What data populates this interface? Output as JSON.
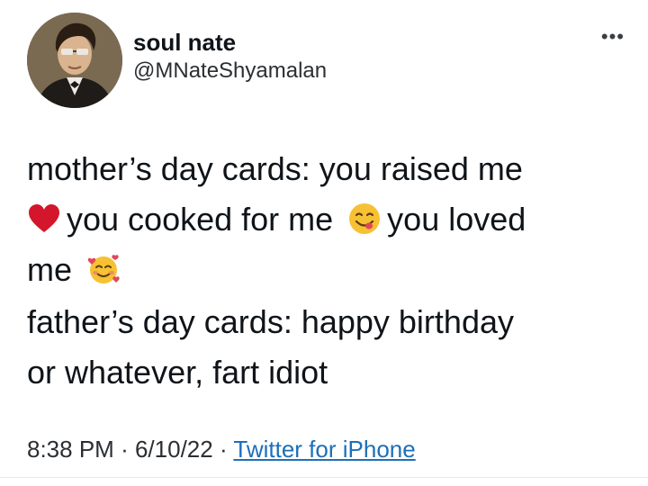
{
  "user": {
    "display_name": "soul nate",
    "handle": "@MNateShyamalan"
  },
  "tweet": {
    "line1_a": "mother’s day cards: you raised me",
    "line2_a": "you cooked for me",
    "line2_b": "you loved",
    "line3_a": "me",
    "para2_line1": "father’s day cards: happy birthday",
    "para2_line2": "or whatever, fart idiot"
  },
  "meta": {
    "time": "8:38 PM",
    "sep1": "·",
    "date": "6/10/22",
    "sep2": "·",
    "source": "Twitter for iPhone"
  },
  "icons": {
    "more": "more-options-icon",
    "emoji1": "red-heart-emoji",
    "emoji2": "savoring-food-emoji",
    "emoji3": "smiling-face-with-hearts-emoji"
  },
  "colors": {
    "link": "#1d6fb8",
    "heart": "#d3162b"
  }
}
